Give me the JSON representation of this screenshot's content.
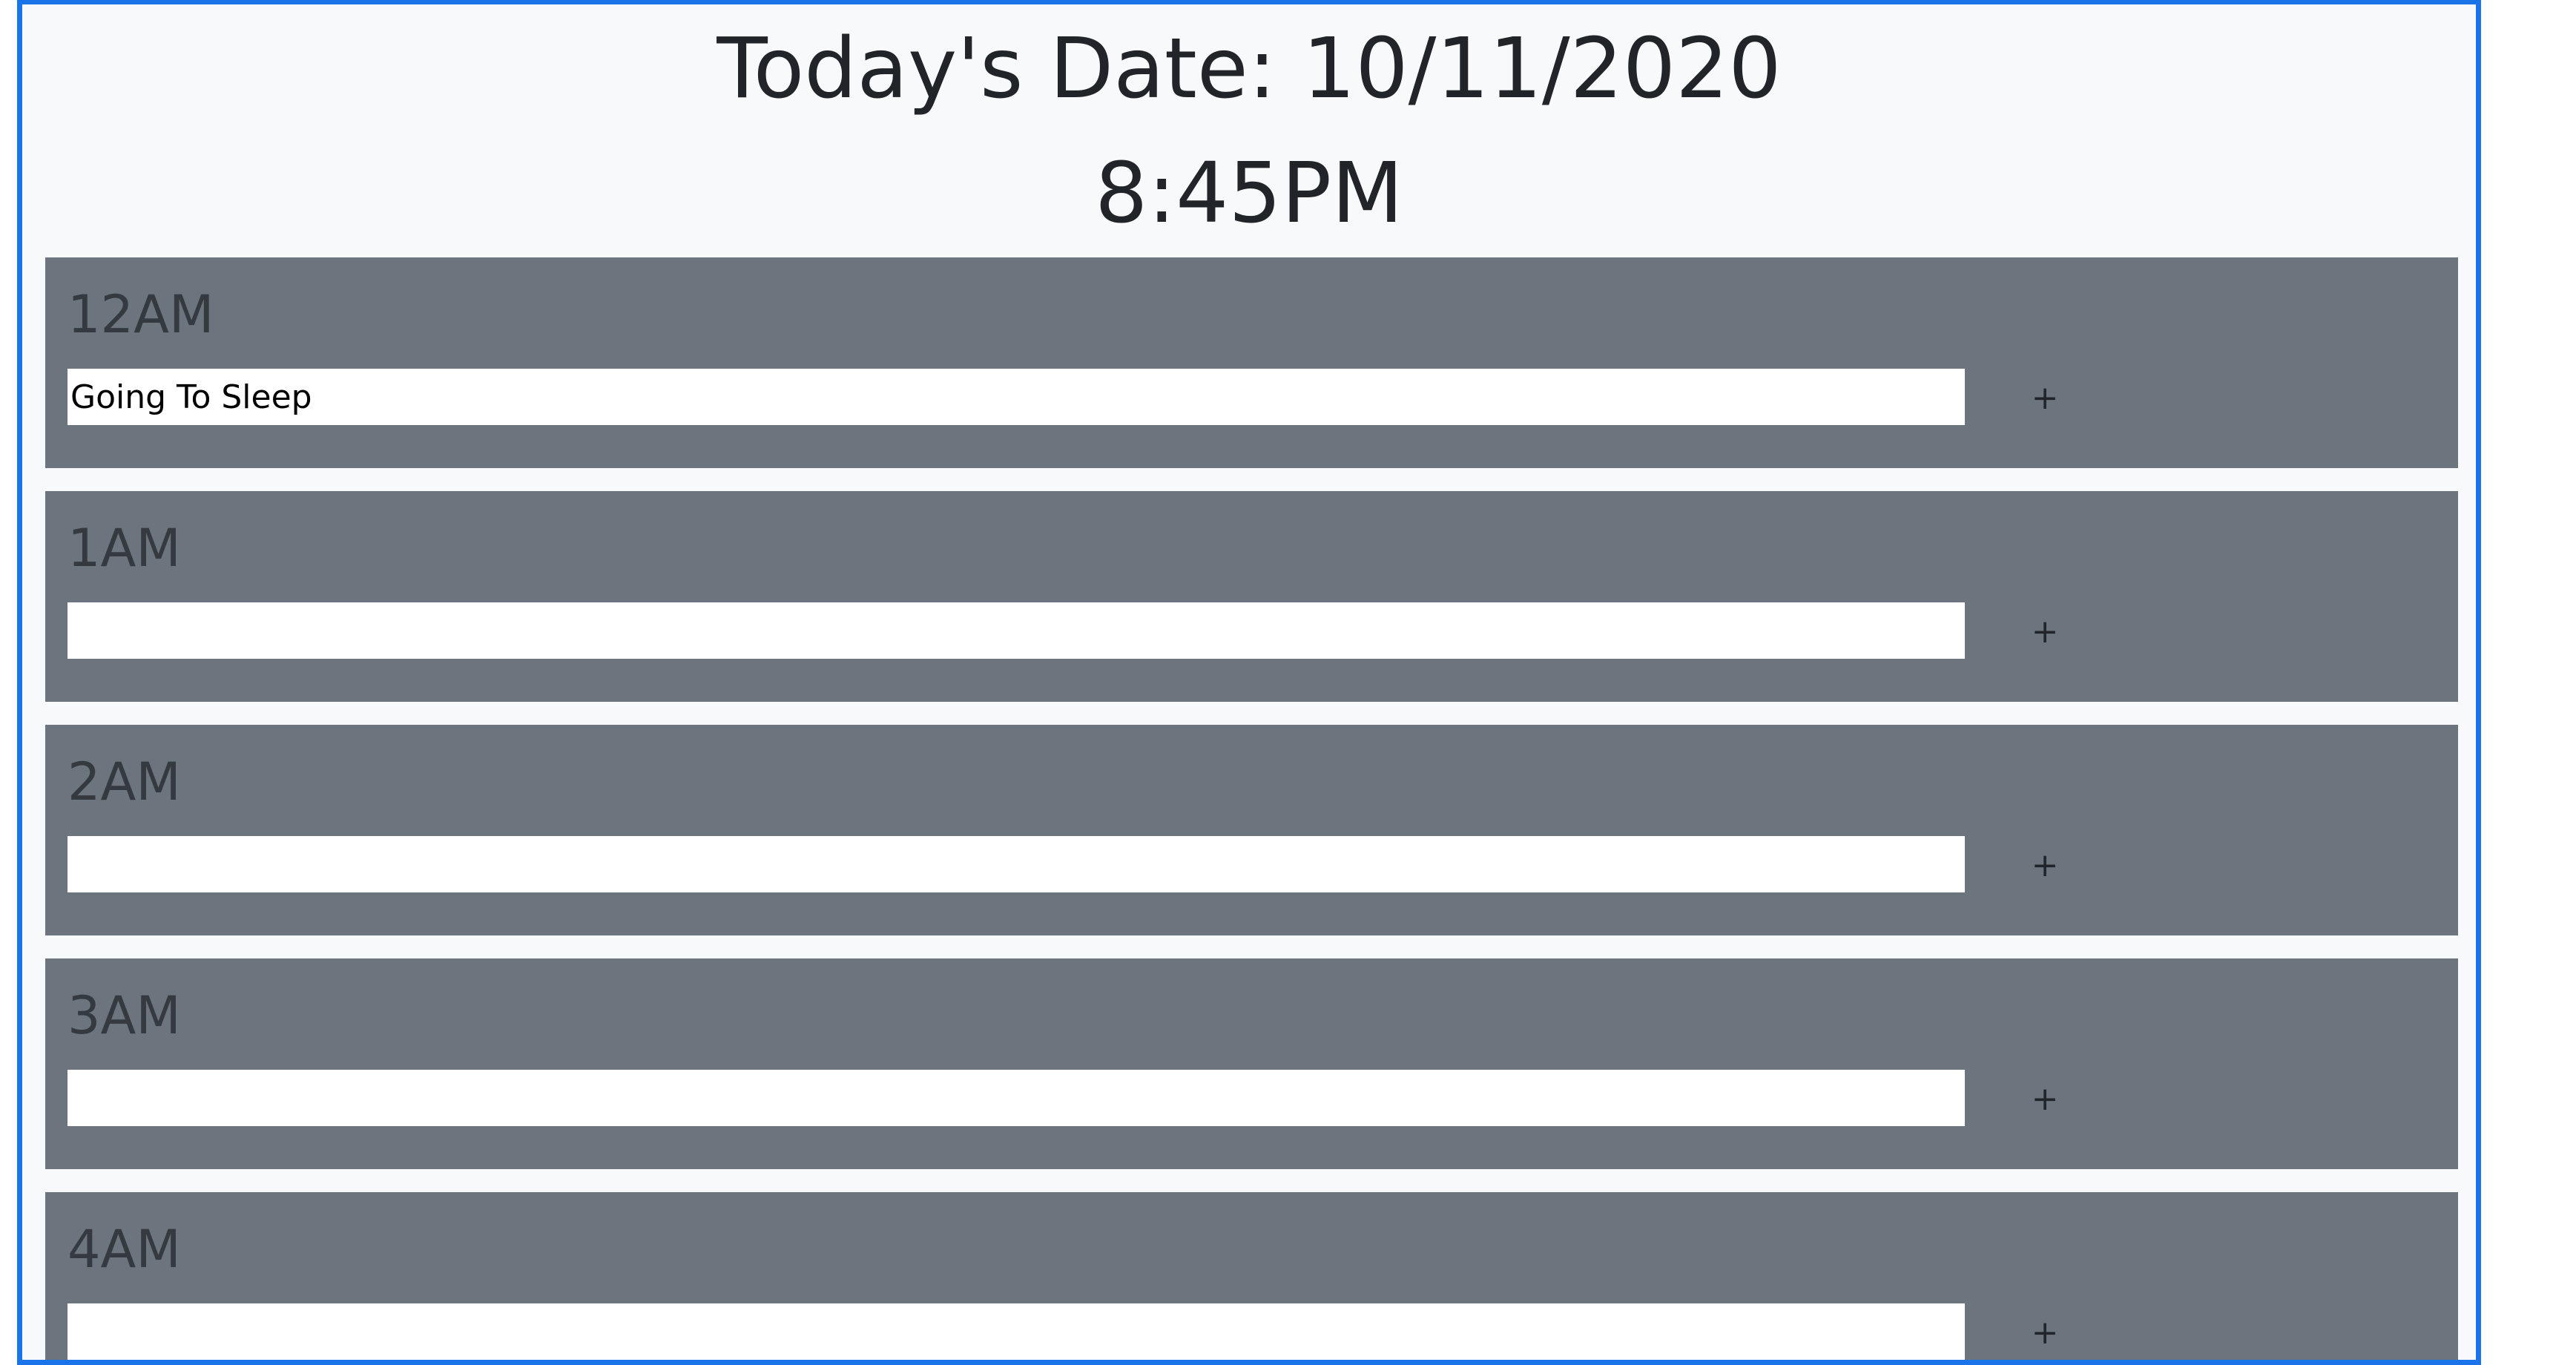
{
  "header": {
    "date_text": "Today's Date: 10/11/2020",
    "time_text": "8:45PM"
  },
  "schedule": [
    {
      "hour": "12AM",
      "task": "Going To Sleep",
      "add_label": "+"
    },
    {
      "hour": "1AM",
      "task": "",
      "add_label": "+"
    },
    {
      "hour": "2AM",
      "task": "",
      "add_label": "+"
    },
    {
      "hour": "3AM",
      "task": "",
      "add_label": "+"
    },
    {
      "hour": "4AM",
      "task": "",
      "add_label": "+"
    }
  ],
  "colors": {
    "frame_border": "#1a73e8",
    "page_background": "#f8f9fa",
    "hour_block": "#6c757d",
    "input_background": "#ffffff"
  }
}
